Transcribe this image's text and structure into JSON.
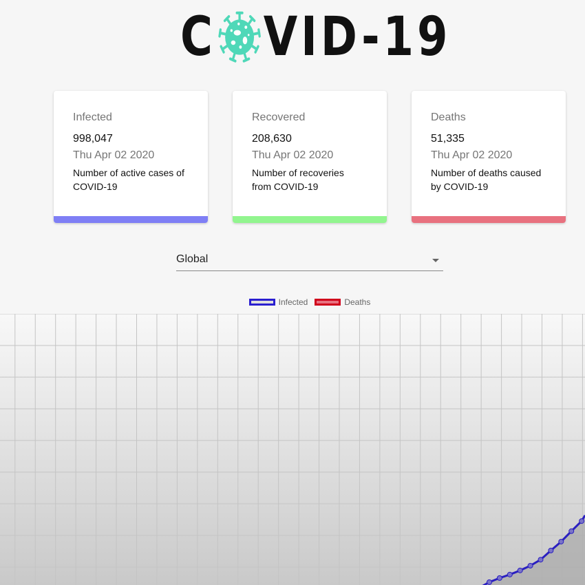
{
  "header": {
    "logo_text_left": "C",
    "logo_text_right": "VID-19",
    "logo_icon": "virus-icon",
    "logo_color": "#4fd8b8"
  },
  "cards": [
    {
      "title": "Infected",
      "value": "998,047",
      "date": "Thu Apr 02 2020",
      "description": "Number of active cases of COVID-19",
      "color": "#7f7ff5"
    },
    {
      "title": "Recovered",
      "value": "208,630",
      "date": "Thu Apr 02 2020",
      "description": "Number of recoveries from COVID-19",
      "color": "#92f58f"
    },
    {
      "title": "Deaths",
      "value": "51,335",
      "date": "Thu Apr 02 2020",
      "description": "Number of deaths caused by COVID-19",
      "color": "#e8717f"
    }
  ],
  "country_select": {
    "value": "Global"
  },
  "chart_data": {
    "type": "line",
    "legend": [
      {
        "name": "Infected",
        "border": "#2a1fd0",
        "fill": "#dedede"
      },
      {
        "name": "Deaths",
        "border": "#d0001c",
        "fill": "#e8717f"
      }
    ],
    "legend_position": "top",
    "grid": true,
    "series": [
      {
        "name": "Infected",
        "values": [
          0.09,
          0.22,
          0.33,
          0.46,
          0.61,
          0.8,
          1.09,
          1.37,
          1.7,
          2.02
        ]
      }
    ]
  }
}
